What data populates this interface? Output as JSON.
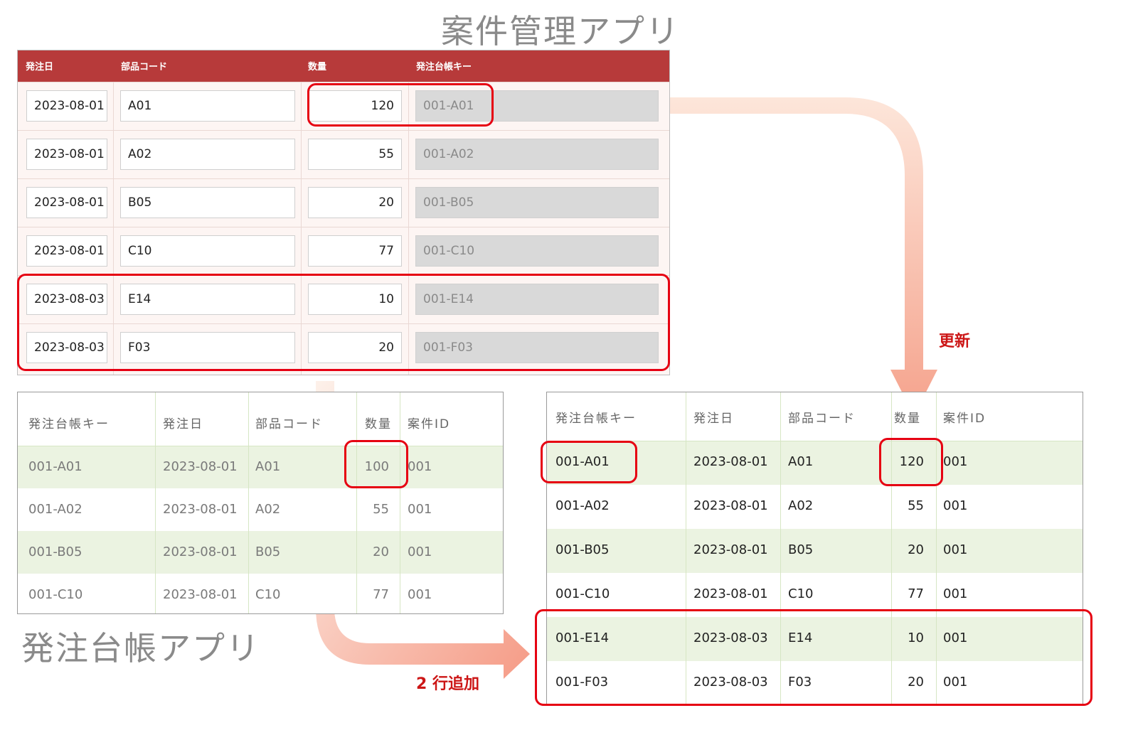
{
  "titles": {
    "project_app": "案件管理アプリ",
    "ledger_app": "発注台帳アプリ"
  },
  "form": {
    "headers": [
      "発注日",
      "部品コード",
      "数量",
      "発注台帳キー"
    ],
    "rows": [
      {
        "date": "2023-08-01",
        "part": "A01",
        "qty": "120",
        "key": "001-A01"
      },
      {
        "date": "2023-08-01",
        "part": "A02",
        "qty": "55",
        "key": "001-A02"
      },
      {
        "date": "2023-08-01",
        "part": "B05",
        "qty": "20",
        "key": "001-B05"
      },
      {
        "date": "2023-08-01",
        "part": "C10",
        "qty": "77",
        "key": "001-C10"
      },
      {
        "date": "2023-08-03",
        "part": "E14",
        "qty": "10",
        "key": "001-E14"
      },
      {
        "date": "2023-08-03",
        "part": "F03",
        "qty": "20",
        "key": "001-F03"
      }
    ]
  },
  "ledger_before": {
    "headers": [
      "発注台帳キー",
      "発注日",
      "部品コード",
      "数量",
      "案件ID"
    ],
    "rows": [
      {
        "key": "001-A01",
        "date": "2023-08-01",
        "part": "A01",
        "qty": "100",
        "project": "001"
      },
      {
        "key": "001-A02",
        "date": "2023-08-01",
        "part": "A02",
        "qty": "55",
        "project": "001"
      },
      {
        "key": "001-B05",
        "date": "2023-08-01",
        "part": "B05",
        "qty": "20",
        "project": "001"
      },
      {
        "key": "001-C10",
        "date": "2023-08-01",
        "part": "C10",
        "qty": "77",
        "project": "001"
      }
    ]
  },
  "ledger_after": {
    "headers": [
      "発注台帳キー",
      "発注日",
      "部品コード",
      "数量",
      "案件ID"
    ],
    "rows": [
      {
        "key": "001-A01",
        "date": "2023-08-01",
        "part": "A01",
        "qty": "120",
        "project": "001"
      },
      {
        "key": "001-A02",
        "date": "2023-08-01",
        "part": "A02",
        "qty": "55",
        "project": "001"
      },
      {
        "key": "001-B05",
        "date": "2023-08-01",
        "part": "B05",
        "qty": "20",
        "project": "001"
      },
      {
        "key": "001-C10",
        "date": "2023-08-01",
        "part": "C10",
        "qty": "77",
        "project": "001"
      },
      {
        "key": "001-E14",
        "date": "2023-08-03",
        "part": "E14",
        "qty": "10",
        "project": "001"
      },
      {
        "key": "001-F03",
        "date": "2023-08-03",
        "part": "F03",
        "qty": "20",
        "project": "001"
      }
    ]
  },
  "labels": {
    "update": "更新",
    "add_rows": "2 行追加"
  },
  "colors": {
    "header_red": "#b73a3a",
    "highlight": "#e60012",
    "row_green": "#ebf3e1",
    "arrow_start": "#fde3d6",
    "arrow_end": "#f59b86"
  }
}
